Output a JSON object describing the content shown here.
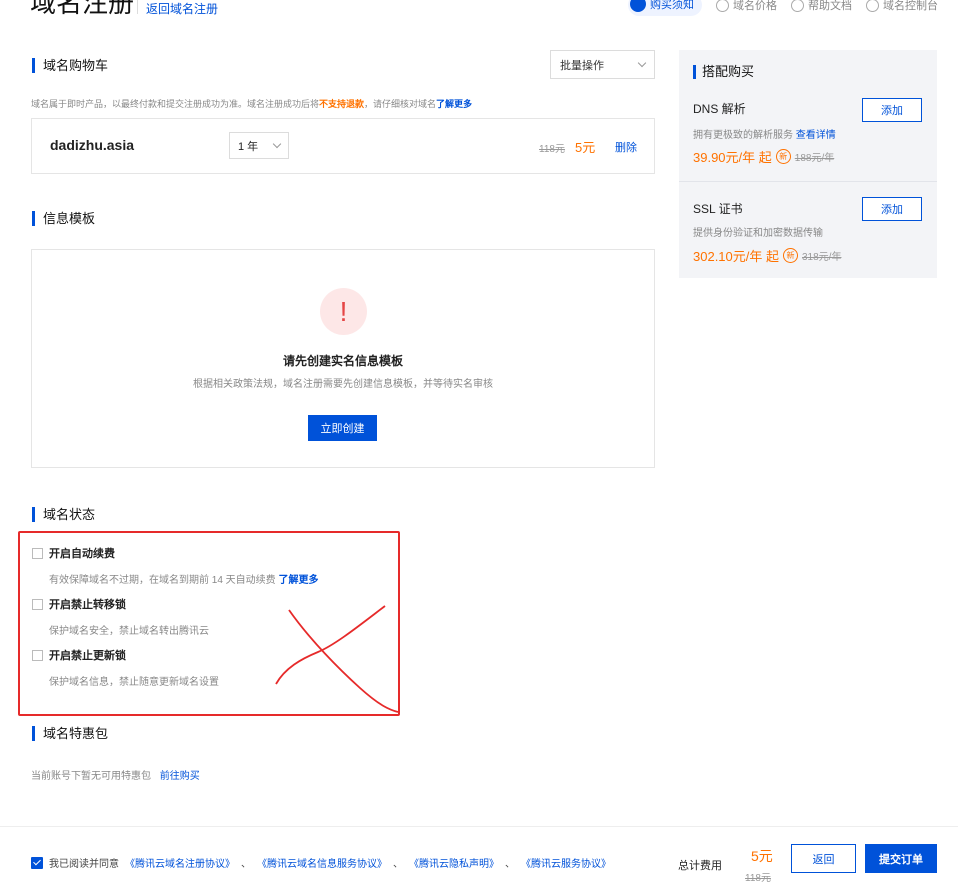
{
  "header": {
    "title": "域名注册",
    "back_link": "返回域名注册",
    "links": [
      {
        "label": "购买须知",
        "icon": "doc-icon",
        "active": true
      },
      {
        "label": "域名价格",
        "icon": "price-icon",
        "active": false
      },
      {
        "label": "帮助文档",
        "icon": "help-icon",
        "active": false
      },
      {
        "label": "域名控制台",
        "icon": "grid-icon",
        "active": false
      }
    ]
  },
  "cart": {
    "title": "域名购物车",
    "bulk_label": "批量操作",
    "note_prefix": "域名属于即时产品，以最终付款和提交注册成功为准。域名注册成功后将",
    "note_bold": "不支持退款",
    "note_middle": "，请仔细核对域名",
    "note_link": "了解更多",
    "item": {
      "domain": "dadizhu.asia",
      "years": "1 年",
      "old_price": "118元",
      "price": "5元",
      "delete": "删除"
    }
  },
  "template": {
    "title": "信息模板",
    "warn_symbol": "!",
    "heading": "请先创建实名信息模板",
    "desc": "根据相关政策法规，域名注册需要先创建信息模板，并等待实名审核",
    "button": "立即创建"
  },
  "status": {
    "title": "域名状态",
    "options": [
      {
        "label": "开启自动续费",
        "desc": "有效保障域名不过期，在域名到期前 14 天自动续费",
        "link": "了解更多",
        "checked": false
      },
      {
        "label": "开启禁止转移锁",
        "desc": "保护域名安全，禁止域名转出腾讯云",
        "link": "",
        "checked": false
      },
      {
        "label": "开启禁止更新锁",
        "desc": "保护域名信息，禁止随意更新域名设置",
        "link": "",
        "checked": false
      }
    ],
    "annotation_color": "#e62a2a"
  },
  "package": {
    "title": "域名特惠包",
    "text": "当前账号下暂无可用特惠包",
    "link": "前往购买"
  },
  "side": {
    "title": "搭配购买",
    "products": [
      {
        "name": "DNS 解析",
        "desc": "拥有更极致的解析服务",
        "desc_link": "查看详情",
        "price": "39.90元/年 起",
        "badge": "新",
        "old_price": "188元/年",
        "button": "添加"
      },
      {
        "name": "SSL 证书",
        "desc": "提供身份验证和加密数据传输",
        "desc_link": "",
        "price": "302.10元/年 起",
        "badge": "新",
        "old_price": "318元/年",
        "button": "添加"
      }
    ]
  },
  "footer": {
    "agree_prefix": "我已阅读并同意",
    "agreements": [
      "《腾讯云域名注册协议》",
      "《腾讯云域名信息服务协议》",
      "《腾讯云隐私声明》",
      "《腾讯云服务协议》"
    ],
    "separator": "、",
    "total_label": "总计费用",
    "total_price": "5元",
    "total_old": "118元",
    "back_button": "返回",
    "submit_button": "提交订单",
    "agreed": true
  },
  "colors": {
    "accent": "#0052d9",
    "price": "#ff7200",
    "warn": "#e54545"
  }
}
